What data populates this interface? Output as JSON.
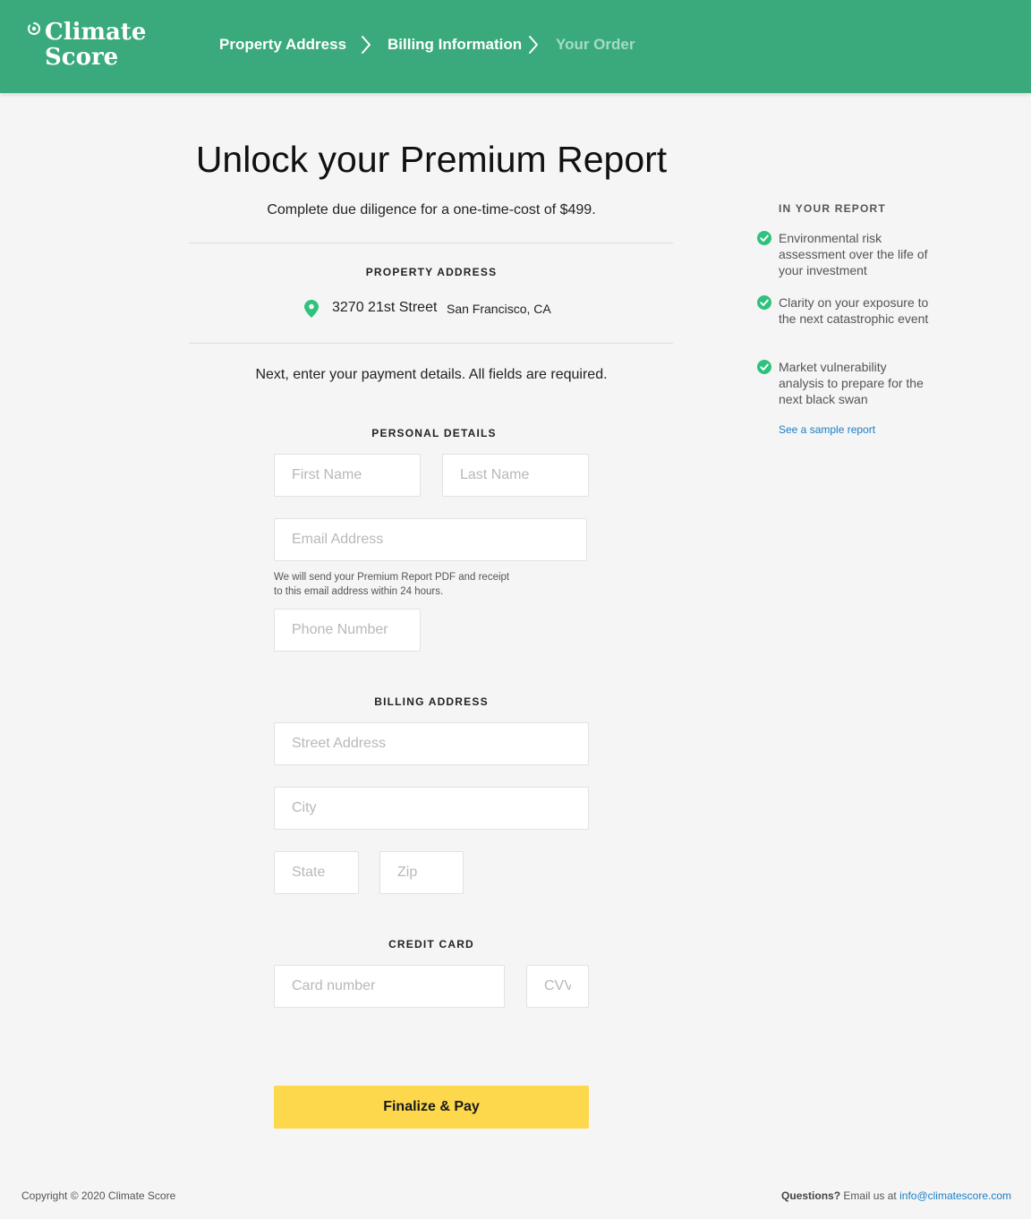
{
  "header": {
    "logo_line1": "Climate",
    "logo_line2": "Score",
    "steps": [
      {
        "label": "Property Address",
        "state": "complete"
      },
      {
        "label": "Billing Information",
        "state": "current"
      },
      {
        "label": "Your Order",
        "state": "upcoming"
      }
    ],
    "brand_color": "#3aaa7c"
  },
  "main": {
    "title": "Unlock your Premium Report",
    "subtitle": "Complete due diligence for a one-time-cost of $499.",
    "property": {
      "label": "PROPERTY ADDRESS",
      "icon": "map-pin-icon",
      "street": "3270 21st Street",
      "city": "San Francisco, CA"
    },
    "instructions": "Next, enter your payment details. All fields are required.",
    "personal": {
      "label": "PERSONAL DETAILS",
      "first_name_placeholder": "First Name",
      "last_name_placeholder": "Last Name",
      "email_placeholder": "Email Address",
      "email_hint": "We will send your Premium Report PDF and receipt to this email address within 24 hours.",
      "phone_placeholder": "Phone Number"
    },
    "billing": {
      "label": "BILLING ADDRESS",
      "street_placeholder": "Street Address",
      "city_placeholder": "City",
      "state_placeholder": "State",
      "zip_placeholder": "Zip"
    },
    "card": {
      "label": "CREDIT CARD",
      "number_placeholder": "Card number",
      "cvv_placeholder": "CVV"
    },
    "pay_button": "Finalize & Pay",
    "pay_button_color": "#fdd84c"
  },
  "sidebar": {
    "title": "IN YOUR REPORT",
    "benefits": [
      "Environmental risk assessment over the life of your investment",
      "Clarity on your exposure to the next catastrophic event",
      "Market vulnerability analysis to prepare for the next black swan"
    ],
    "check_icon": "check-circle-icon",
    "sample_link": "See a sample report",
    "accent_color": "#2ec27e"
  },
  "footer": {
    "copyright": "Copyright © 2020 Climate Score",
    "questions": "Questions?",
    "email_prefix": "Email us at",
    "email": "info@climatescore.com"
  }
}
